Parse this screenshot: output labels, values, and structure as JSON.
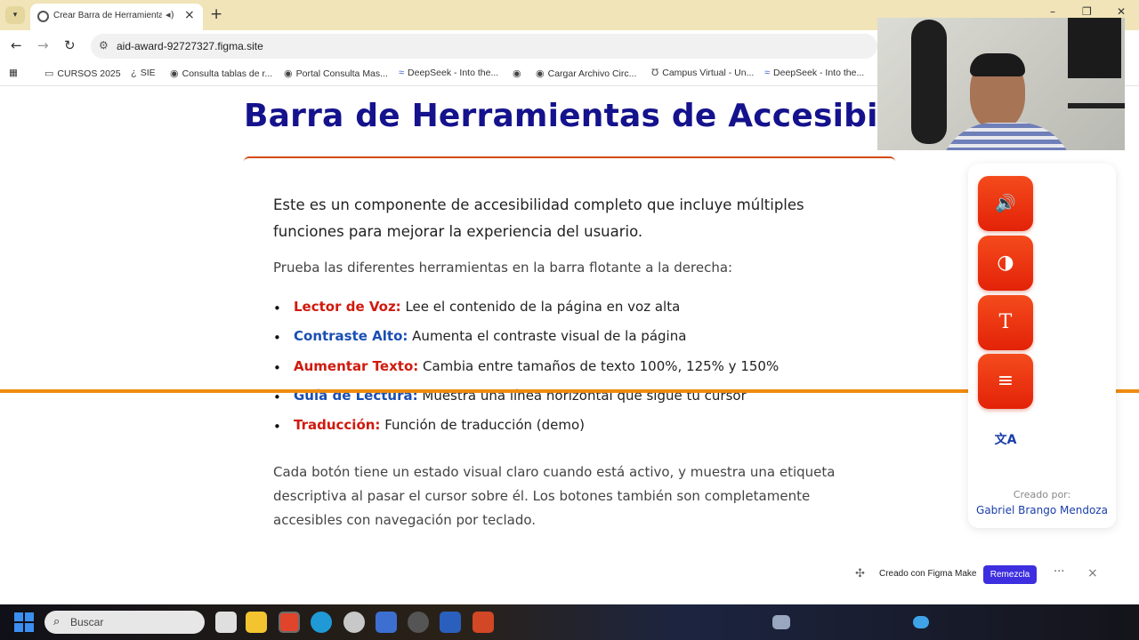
{
  "browser": {
    "tab_title": "Crear Barra de Herramienta",
    "tab_icons": {
      "favicon": "globe-icon",
      "audio": "speaker-icon",
      "close": "close-icon"
    },
    "new_tab": "+",
    "url": "aid-award-92727327.figma.site",
    "bookmarks": [
      {
        "label": "CURSOS 2025",
        "icon": "folder-icon"
      },
      {
        "label": "SIE",
        "icon": "sie-icon"
      },
      {
        "label": "Consulta tablas de r...",
        "icon": "globe-icon"
      },
      {
        "label": "Portal Consulta Mas...",
        "icon": "globe-icon"
      },
      {
        "label": "DeepSeek - Into the...",
        "icon": "deepseek-icon"
      },
      {
        "label": "",
        "icon": "globe-icon"
      },
      {
        "label": "Cargar Archivo Circ...",
        "icon": "globe-icon"
      },
      {
        "label": "Campus Virtual - Un...",
        "icon": "campus-icon"
      },
      {
        "label": "DeepSeek - Into the...",
        "icon": "deepseek-icon"
      }
    ]
  },
  "page": {
    "title": "Barra de Herramientas de Accesibilidad",
    "intro": "Este es un componente de accesibilidad completo que incluye múltiples funciones para mejorar la experiencia del usuario.",
    "prompt": "Prueba las diferentes herramientas en la barra flotante a la derecha:",
    "features": [
      {
        "name": "Lector de Voz:",
        "desc": " Lee el contenido de la página en voz alta",
        "color": "#d01a0e"
      },
      {
        "name": "Contraste Alto:",
        "desc": " Aumenta el contraste visual de la página",
        "color": "#1a4fb3"
      },
      {
        "name": "Aumentar Texto:",
        "desc": " Cambia entre tamaños de texto 100%, 125% y 150%",
        "color": "#d01a0e"
      },
      {
        "name": "Guía de Lectura:",
        "desc": " Muestra una línea horizontal que sigue tu cursor",
        "color": "#1a4fb3"
      },
      {
        "name": "Traducción:",
        "desc": " Función de traducción (demo)",
        "color": "#d01a0e"
      }
    ],
    "footer_text": "Cada botón tiene un estado visual claro cuando está activo, y muestra una etiqueta descriptiva al pasar el cursor sobre él. Los botones también son completamente accesibles con navegación por teclado.",
    "reading_guide_color": "#ef8b10"
  },
  "toolbar": {
    "buttons": [
      {
        "id": "voice-reader",
        "icon": "speaker-icon",
        "glyph": "🔊"
      },
      {
        "id": "high-contrast",
        "icon": "contrast-icon",
        "glyph": "◑"
      },
      {
        "id": "text-size",
        "icon": "text-size-icon",
        "glyph": "T"
      },
      {
        "id": "reading-guide",
        "icon": "reading-guide-icon",
        "glyph": "≡"
      }
    ],
    "translate": {
      "icon": "translate-icon",
      "glyph": "文A"
    },
    "credit_label": "Creado por:",
    "credit_name": "Gabriel Brango Mendoza",
    "accent": "#e8300c"
  },
  "figma": {
    "label": "Creado con Figma Make",
    "remix": "Remezcla",
    "more": "···",
    "close": "×"
  },
  "taskbar": {
    "search_placeholder": "Buscar"
  }
}
